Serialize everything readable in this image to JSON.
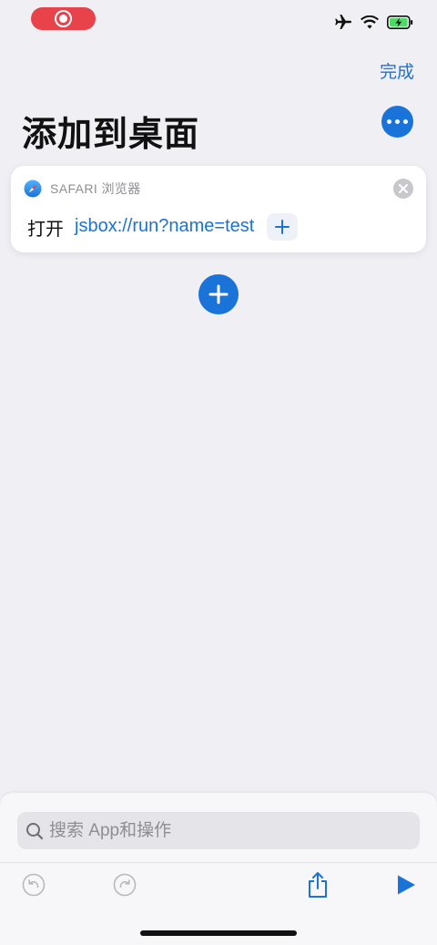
{
  "nav": {
    "done_label": "完成",
    "title": "添加到桌面"
  },
  "action": {
    "app_label": "SAFARI 浏览器",
    "verb": "打开",
    "url": "jsbox://run?name=test"
  },
  "search": {
    "placeholder": "搜索 App和操作"
  },
  "colors": {
    "accent": "#1a73d9",
    "background": "#efeff4",
    "record_red": "#e8434b",
    "battery_green": "#4cd964"
  },
  "icons": [
    "record-icon",
    "airplane-icon",
    "wifi-icon",
    "battery-charging-icon",
    "more-icon",
    "safari-icon",
    "clear-icon",
    "plus-icon",
    "search-icon",
    "undo-icon",
    "redo-icon",
    "share-icon",
    "play-icon"
  ]
}
